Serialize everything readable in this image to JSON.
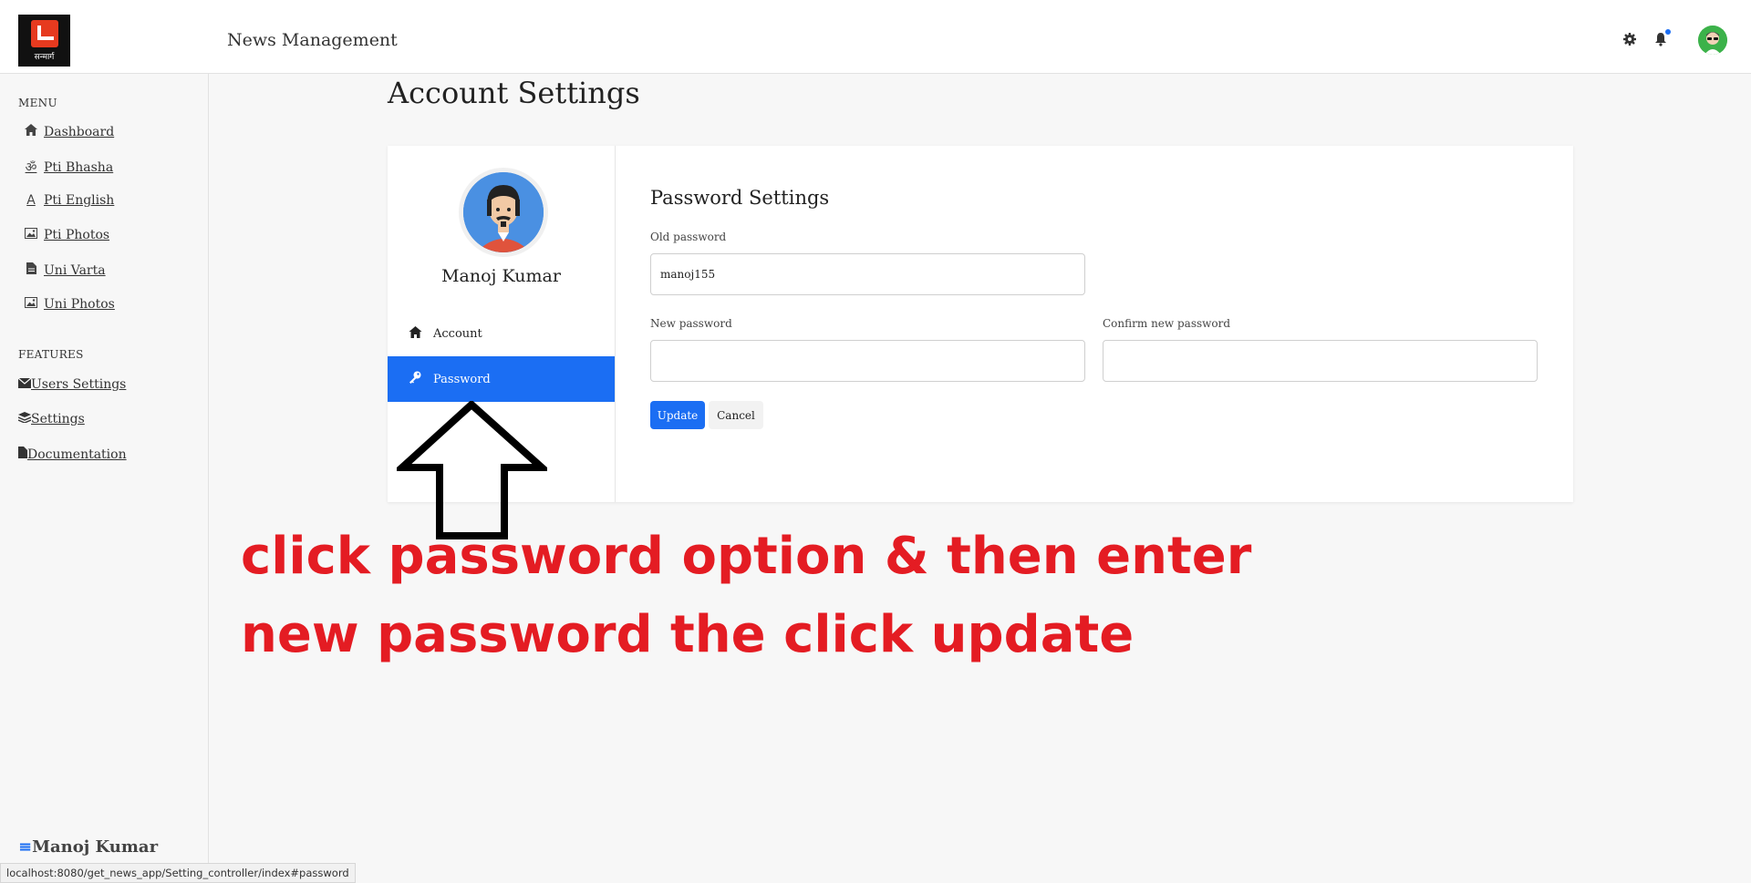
{
  "header": {
    "logo_text": "सन्मार्ग",
    "brand": "News Management",
    "icons": [
      "gear-icon",
      "bell-icon",
      "user-avatar"
    ]
  },
  "sidebar": {
    "menu_title": "MENU",
    "menu_items": [
      {
        "label": "Dashboard",
        "icon": "home-icon"
      },
      {
        "label": "Pti Bhasha",
        "icon": "om-icon"
      },
      {
        "label": "Pti English",
        "icon": "letter-a-icon"
      },
      {
        "label": "Pti Photos",
        "icon": "image-icon"
      },
      {
        "label": "Uni Varta",
        "icon": "document-icon"
      },
      {
        "label": "Uni Photos",
        "icon": "image-icon"
      }
    ],
    "features_title": "FEATURES",
    "feature_items": [
      {
        "label": "Users Settings",
        "icon": "envelope-icon"
      },
      {
        "label": "Settings",
        "icon": "layers-icon"
      },
      {
        "label": "Documentation",
        "icon": "file-icon"
      }
    ],
    "user_name": "Manoj Kumar"
  },
  "main": {
    "title": "Account Settings",
    "profile_name": "Manoj Kumar",
    "tabs": [
      {
        "label": "Account",
        "icon": "home-icon",
        "active": false
      },
      {
        "label": "Password",
        "icon": "key-icon",
        "active": true
      }
    ],
    "section_title": "Password Settings",
    "old_password_label": "Old password",
    "old_password_value": "manoj155",
    "new_password_label": "New password",
    "new_password_value": "",
    "confirm_password_label": "Confirm new password",
    "confirm_password_value": "",
    "update_label": "Update",
    "cancel_label": "Cancel"
  },
  "annotation": {
    "line1": "click password option & then enter",
    "line2": "new password the click update"
  },
  "status_url": "localhost:8080/get_news_app/Setting_controller/index#password",
  "colors": {
    "accent": "#1b6ef3",
    "annotation": "#e41c23"
  }
}
